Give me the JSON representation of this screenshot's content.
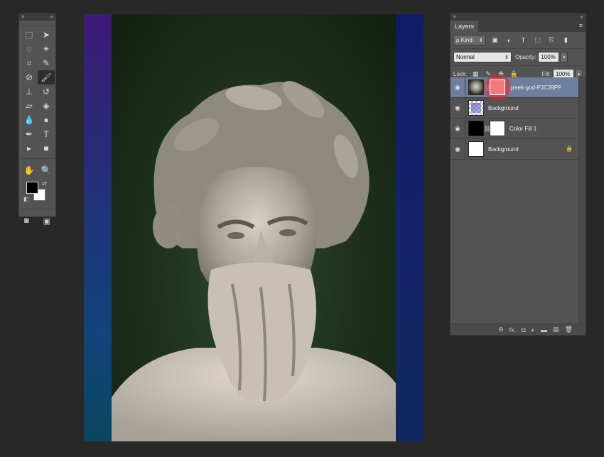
{
  "tools_panel": {
    "close_glyph": "×",
    "collapse_glyph": "«",
    "tools": [
      {
        "name": "marquee-tool",
        "glyph": "⬚"
      },
      {
        "name": "move-tool",
        "glyph": "➤"
      },
      {
        "name": "lasso-tool",
        "glyph": "◌"
      },
      {
        "name": "magic-wand-tool",
        "glyph": "✴"
      },
      {
        "name": "crop-tool",
        "glyph": "⌗"
      },
      {
        "name": "eyedropper-tool",
        "glyph": "✎"
      },
      {
        "name": "healing-brush-tool",
        "glyph": "⊘"
      },
      {
        "name": "brush-tool",
        "glyph": "🖌"
      },
      {
        "name": "clone-stamp-tool",
        "glyph": "⊥"
      },
      {
        "name": "history-brush-tool",
        "glyph": "↺"
      },
      {
        "name": "eraser-tool",
        "glyph": "▱"
      },
      {
        "name": "paint-bucket-tool",
        "glyph": "◈"
      },
      {
        "name": "blur-tool",
        "glyph": "💧"
      },
      {
        "name": "dodge-tool",
        "glyph": "●"
      },
      {
        "name": "pen-tool",
        "glyph": "✒"
      },
      {
        "name": "type-tool",
        "glyph": "T"
      },
      {
        "name": "path-selection-tool",
        "glyph": "▸"
      },
      {
        "name": "rectangle-tool",
        "glyph": "■"
      },
      {
        "name": "hand-tool",
        "glyph": "✋"
      },
      {
        "name": "zoom-tool",
        "glyph": "🔍"
      }
    ],
    "quick_mask_glyph": "◙",
    "screen_mode_glyph": "▣"
  },
  "layers_panel": {
    "close_glyph": "×",
    "collapse_glyph": "«",
    "tab_label": "Layers",
    "menu_glyph": "≡",
    "filter_kind": "ρ Kind",
    "blend_mode": "Normal",
    "opacity_label": "Opacity:",
    "opacity_value": "100%",
    "lock_label": "Lock:",
    "fill_label": "Fill:",
    "fill_value": "100%",
    "layers": [
      {
        "name": "greek-god-PJC39PF",
        "selected": true
      },
      {
        "name": "Background",
        "selected": false
      },
      {
        "name": "Color Fill 1",
        "selected": false
      },
      {
        "name": "Background",
        "selected": false,
        "locked": true
      }
    ],
    "footer_icons": [
      "⊖",
      "fx.",
      "◘",
      "◐",
      "▬",
      "▤",
      "🗑"
    ]
  }
}
